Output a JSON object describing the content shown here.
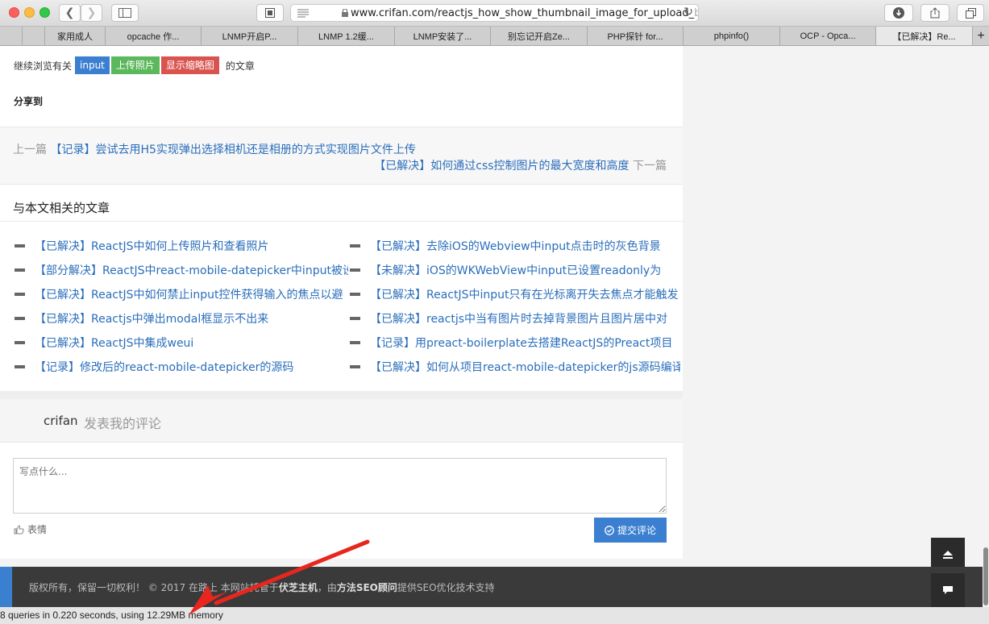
{
  "browser": {
    "url_main": "www.crifan.com/reactjs_how_show_thumbnail_image_for_upload_",
    "url_fade": "b",
    "tabs": [
      "家用成人",
      "opcache 作...",
      "LNMP开启P...",
      "LNMP 1.2缓...",
      "LNMP安装了...",
      "别忘记开启Ze...",
      "PHP探针 for...",
      "phpinfo()",
      "OCP - Opca...",
      "【已解决】Re..."
    ],
    "new_tab_label": "+"
  },
  "tags": {
    "prefix": "继续浏览有关",
    "items": [
      {
        "label": "input",
        "color": "#3b7fd0"
      },
      {
        "label": "上传照片",
        "color": "#5cb85c"
      },
      {
        "label": "显示缩略图",
        "color": "#d9534f"
      }
    ],
    "suffix": "的文章"
  },
  "share": {
    "label": "分享到"
  },
  "post_nav": {
    "prev_label": "上一篇",
    "prev_title": "【记录】尝试去用H5实现弹出选择相机还是相册的方式实现图片文件上传",
    "next_title": "【已解决】如何通过css控制图片的最大宽度和高度",
    "next_label": "下一篇"
  },
  "related": {
    "heading": "与本文相关的文章",
    "left": [
      "【已解决】ReactJS中如何上传照片和查看照片",
      "【部分解决】ReactJS中react-mobile-datepicker中input被设置",
      "【已解决】ReactJS中如何禁止input控件获得输入的焦点以避",
      "【已解决】Reactjs中弹出modal框显示不出来",
      "【已解决】ReactJS中集成weui",
      "【记录】修改后的react-mobile-datepicker的源码"
    ],
    "right": [
      "【已解决】去除iOS的Webview中input点击时的灰色背景",
      "【未解决】iOS的WKWebView中input已设置readonly为",
      "【已解决】ReactJS中input只有在光标离开失去焦点才能触发",
      "【已解决】reactjs中当有图片时去掉背景图片且图片居中对",
      "【记录】用preact-boilerplate去搭建ReactJS的Preact项目",
      "【已解决】如何从项目react-mobile-datepicker的js源码编译并"
    ]
  },
  "comment": {
    "username": "crifan",
    "heading": "发表我的评论",
    "placeholder": "写点什么...",
    "emoji_label": "表情",
    "submit_label": "提交评论"
  },
  "footer": {
    "copyright": "版权所有，保留一切权利！ © 2017 在路上 本网站托管于",
    "host": "伏芝主机",
    "mid": "，由",
    "seo": "方法SEO顾问",
    "tail": "提供SEO优化技术支持"
  },
  "status": {
    "text": "8 queries in 0.220 seconds, using 12.29MB memory"
  },
  "colors": {
    "link": "#2a6ebb",
    "accent": "#3b7fd0",
    "arrow": "#e8261e"
  }
}
